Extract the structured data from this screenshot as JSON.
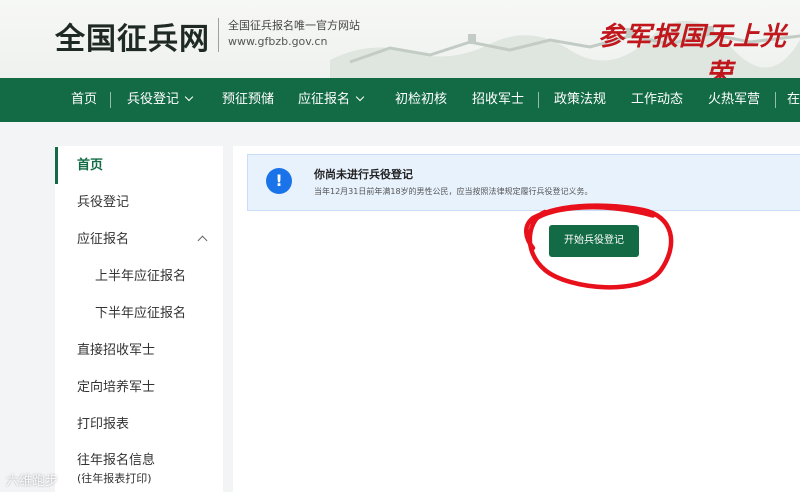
{
  "header": {
    "logo_title": "全国征兵网",
    "logo_subtitle": "全国征兵报名唯一官方网站",
    "logo_url": "www.gfbzb.gov.cn",
    "slogan1": "参军报国",
    "slogan2": "无上光荣"
  },
  "nav": {
    "items": [
      {
        "label": "首页"
      },
      {
        "label": "兵役登记"
      },
      {
        "label": "预征预储"
      },
      {
        "label": "应征报名"
      },
      {
        "label": "初检初核"
      },
      {
        "label": "招收军士"
      },
      {
        "label": "政策法规"
      },
      {
        "label": "工作动态"
      },
      {
        "label": "火热军营"
      },
      {
        "label": "在"
      }
    ]
  },
  "sidebar": {
    "items": [
      {
        "label": "首页"
      },
      {
        "label": "兵役登记"
      },
      {
        "label": "应征报名"
      },
      {
        "label": "上半年应征报名"
      },
      {
        "label": "下半年应征报名"
      },
      {
        "label": "直接招收军士"
      },
      {
        "label": "定向培养军士"
      },
      {
        "label": "打印报表"
      },
      {
        "label": "往年报名信息",
        "sub": "(往年报表打印)"
      }
    ]
  },
  "main": {
    "alert_title": "你尚未进行兵役登记",
    "alert_desc": "当年12月31日前年满18岁的男性公民，应当按照法律规定履行兵役登记义务。",
    "start_button": "开始兵役登记"
  },
  "watermark": "六维跑步",
  "colors": {
    "primary_green": "#136b45",
    "slogan_red": "#c0171d",
    "alert_blue": "#1a73e8",
    "annotation_red": "#e8101a"
  }
}
